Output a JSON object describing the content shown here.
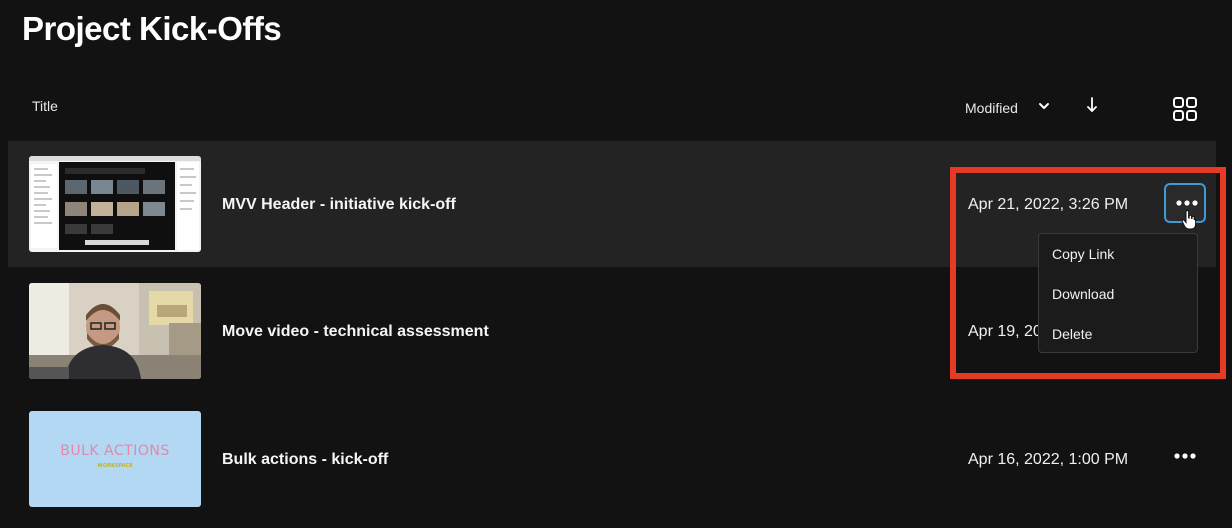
{
  "page": {
    "title": "Project Kick-Offs"
  },
  "list_header": {
    "title_column": "Title",
    "sort_label": "Modified"
  },
  "rows": [
    {
      "title": "MVV Header - initiative kick-off",
      "date": "Apr 21, 2022, 3:26 PM",
      "thumbnail": "screen-recording"
    },
    {
      "title": "Move video - technical assessment",
      "date": "Apr 19, 20",
      "thumbnail": "webcam-person"
    },
    {
      "title": "Bulk actions - kick-off",
      "date": "Apr 16, 2022, 1:00 PM",
      "thumbnail": "bulk-actions-card",
      "thumb_text": "BULK ACTIONS",
      "thumb_subtext": "WORKSPACE"
    }
  ],
  "context_menu": {
    "items": [
      "Copy Link",
      "Download",
      "Delete"
    ]
  },
  "colors": {
    "background": "#121212",
    "selected_row": "#232323",
    "highlight": "#e53a24",
    "focus_ring": "#3e9bd6"
  }
}
